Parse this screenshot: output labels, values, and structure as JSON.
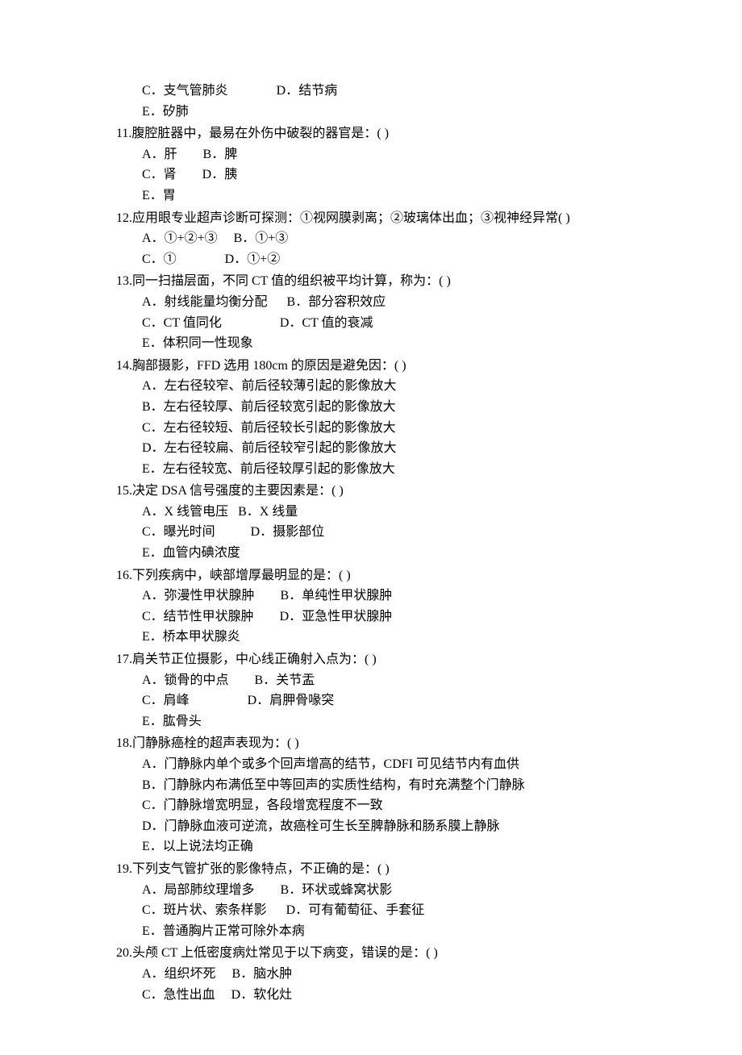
{
  "questions": [
    {
      "stem_prefix": "",
      "stem": "",
      "option_lines": [
        "C．支气管肺炎               D．结节病",
        "E．矽肺"
      ]
    },
    {
      "stem_prefix": "11.",
      "stem": "腹腔脏器中，最易在外伤中破裂的器官是：(          )",
      "option_lines": [
        "A．肝        B．脾",
        "C．肾        D．胰",
        "E．胃"
      ]
    },
    {
      "stem_prefix": "12.",
      "stem": "应用眼专业超声诊断可探测：①视网膜剥离；②玻璃体出血；③视神经异常(          )",
      "option_lines": [
        "A．①+②+③     B．①+③",
        "C．①               D．①+②"
      ]
    },
    {
      "stem_prefix": "13.",
      "stem": "同一扫描层面，不同 CT 值的组织被平均计算，称为：(          )",
      "option_lines": [
        "A．射线能量均衡分配      B．部分容积效应",
        "C．CT 值同化                  D．CT 值的衰减",
        "E．体积同一性现象"
      ]
    },
    {
      "stem_prefix": "14.",
      "stem": "胸部摄影，FFD 选用 180cm 的原因是避免因：(          )",
      "option_lines": [
        "A．左右径较窄、前后径较薄引起的影像放大",
        "B．左右径较厚、前后径较宽引起的影像放大",
        "C．左右径较短、前后径较长引起的影像放大",
        "D．左右径较扁、前后径较窄引起的影像放大",
        "E．左右径较宽、前后径较厚引起的影像放大"
      ]
    },
    {
      "stem_prefix": "15.",
      "stem": "决定 DSA 信号强度的主要因素是：(          )",
      "option_lines": [
        "A．X 线管电压   B．X 线量",
        "C．曝光时间           D．摄影部位",
        "E．血管内碘浓度"
      ]
    },
    {
      "stem_prefix": "16.",
      "stem": "下列疾病中，峡部增厚最明显的是：(          )",
      "option_lines": [
        "A．弥漫性甲状腺肿        B．单纯性甲状腺肿",
        "C．结节性甲状腺肿        D．亚急性甲状腺肿",
        "E．桥本甲状腺炎"
      ]
    },
    {
      "stem_prefix": "17.",
      "stem": "肩关节正位摄影，中心线正确射入点为：(          )",
      "option_lines": [
        "A．锁骨的中点        B．关节盂",
        "C．肩峰                  D．肩胛骨喙突",
        "E．肱骨头"
      ]
    },
    {
      "stem_prefix": "18.",
      "stem": "门静脉癌栓的超声表现为：(          )",
      "option_lines": [
        "A．门静脉内单个或多个回声增高的结节，CDFI 可见结节内有血供",
        "B．门静脉内布满低至中等回声的实质性结构，有时充满整个门静脉",
        "C．门静脉增宽明显，各段增宽程度不一致",
        "D．门静脉血液可逆流，故癌栓可生长至脾静脉和肠系膜上静脉",
        "E．以上说法均正确"
      ]
    },
    {
      "stem_prefix": "19.",
      "stem": "下列支气管扩张的影像特点，不正确的是：(          )",
      "option_lines": [
        "A．局部肺纹理增多        B．环状或蜂窝状影",
        "C．斑片状、索条样影      D．可有葡萄征、手套征",
        "E．普通胸片正常可除外本病"
      ]
    },
    {
      "stem_prefix": "20.",
      "stem": "头颅 CT 上低密度病灶常见于以下病变，错误的是：(          )",
      "option_lines": [
        "A．组织坏死     B．脑水肿",
        "C．急性出血     D．软化灶"
      ]
    }
  ]
}
